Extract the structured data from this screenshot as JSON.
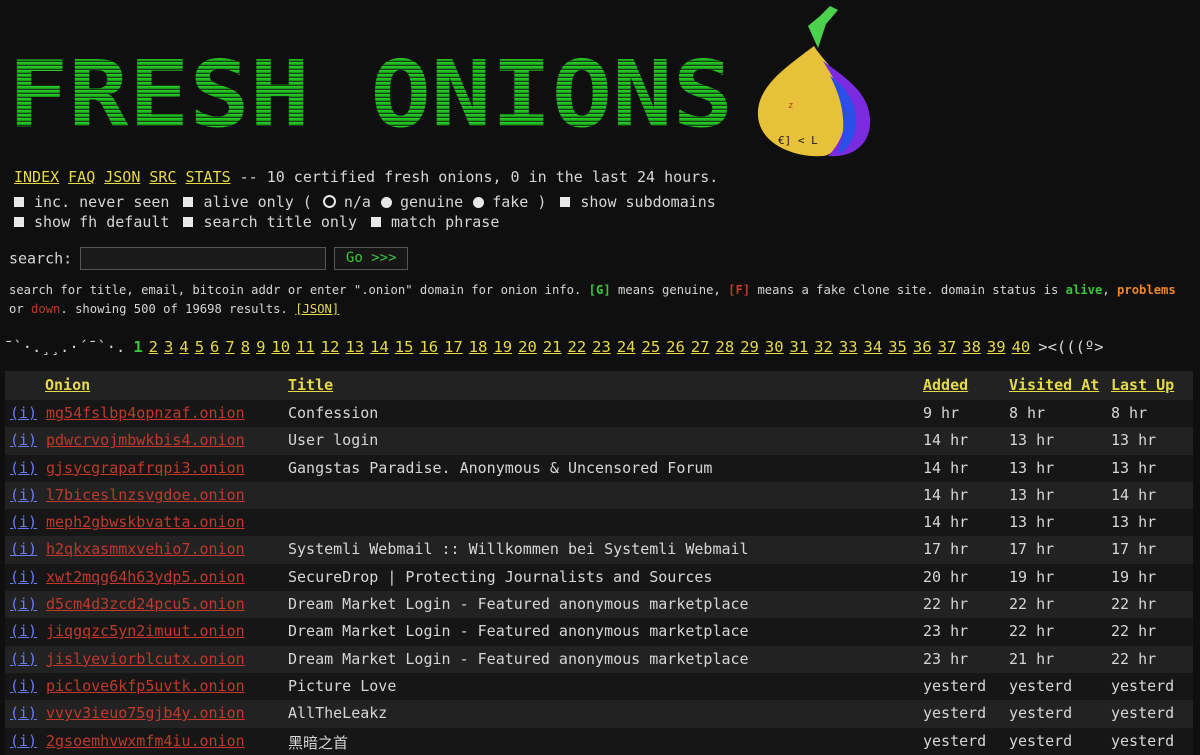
{
  "brand": {
    "logo_text": "FRESH ONIONS"
  },
  "nav": {
    "links": [
      "INDEX",
      "FAQ",
      "JSON",
      "SRC",
      "STATS"
    ],
    "status": "-- 10 certified fresh onions, 0 in the last 24 hours."
  },
  "options": {
    "inc_never_seen": "inc. never seen",
    "alive_only": "alive only (",
    "na": "n/a",
    "genuine": "genuine",
    "fake": "fake )",
    "show_subdomains": "show subdomains",
    "show_fh_default": "show fh default",
    "search_title_only": "search title only",
    "match_phrase": "match phrase"
  },
  "search": {
    "label": "search:",
    "value": "",
    "go_label": "Go >>>"
  },
  "help": {
    "p1": "search for title, email, bitcoin addr or enter \".onion\" domain for onion info.",
    "g_tag": "[G]",
    "p2": "means genuine,",
    "f_tag": "[F]",
    "p3": "means a fake clone site. domain status is",
    "alive": "alive",
    "comma": ",",
    "problems": "problems",
    "or": "or",
    "down": "down",
    "p4": ". showing 500 of 19698 results.",
    "json_link": "[JSON]"
  },
  "pager": {
    "prefix": "¯`·.¸¸.·´¯`·.",
    "current": "1",
    "pages": [
      "2",
      "3",
      "4",
      "5",
      "6",
      "7",
      "8",
      "9",
      "10",
      "11",
      "12",
      "13",
      "14",
      "15",
      "16",
      "17",
      "18",
      "19",
      "20",
      "21",
      "22",
      "23",
      "24",
      "25",
      "26",
      "27",
      "28",
      "29",
      "30",
      "31",
      "32",
      "33",
      "34",
      "35",
      "36",
      "37",
      "38",
      "39",
      "40"
    ],
    "suffix": "><(((º>"
  },
  "table": {
    "headers": {
      "onion": "Onion",
      "title": "Title",
      "added": "Added",
      "visited": "Visited At",
      "last_up": "Last Up"
    },
    "info_label": "(i)",
    "rows": [
      {
        "onion": "mg54fslbp4opnzaf.onion",
        "title": "Confession",
        "added": "9 hr",
        "visited": "8 hr",
        "last_up": "8 hr"
      },
      {
        "onion": "pdwcrvojmbwkbis4.onion",
        "title": "User login",
        "added": "14 hr",
        "visited": "13 hr",
        "last_up": "13 hr"
      },
      {
        "onion": "gjsycgrapafrqpi3.onion",
        "title": "Gangstas Paradise. Anonymous & Uncensored Forum",
        "added": "14 hr",
        "visited": "13 hr",
        "last_up": "13 hr"
      },
      {
        "onion": "l7biceslnzsvgdoe.onion",
        "title": "",
        "added": "14 hr",
        "visited": "13 hr",
        "last_up": "14 hr"
      },
      {
        "onion": "meph2gbwskbvatta.onion",
        "title": "",
        "added": "14 hr",
        "visited": "13 hr",
        "last_up": "13 hr"
      },
      {
        "onion": "h2qkxasmmxvehio7.onion",
        "title": "Systemli Webmail :: Willkommen bei Systemli Webmail",
        "added": "17 hr",
        "visited": "17 hr",
        "last_up": "17 hr"
      },
      {
        "onion": "xwt2mqg64h63ydp5.onion",
        "title": "SecureDrop | Protecting Journalists and Sources",
        "added": "20 hr",
        "visited": "19 hr",
        "last_up": "19 hr"
      },
      {
        "onion": "d5cm4d3zcd24pcu5.onion",
        "title": "Dream Market Login - Featured anonymous marketplace",
        "added": "22 hr",
        "visited": "22 hr",
        "last_up": "22 hr"
      },
      {
        "onion": "jiqgqzc5yn2imuut.onion",
        "title": "Dream Market Login - Featured anonymous marketplace",
        "added": "23 hr",
        "visited": "22 hr",
        "last_up": "22 hr"
      },
      {
        "onion": "jislyeviorblcutx.onion",
        "title": "Dream Market Login - Featured anonymous marketplace",
        "added": "23 hr",
        "visited": "21 hr",
        "last_up": "22 hr"
      },
      {
        "onion": "piclove6kfp5uvtk.onion",
        "title": "Picture Love",
        "added": "yesterd",
        "visited": "yesterd",
        "last_up": "yesterd"
      },
      {
        "onion": "vvyv3ieuo75gjb4y.onion",
        "title": "AllTheLeakz",
        "added": "yesterd",
        "visited": "yesterd",
        "last_up": "yesterd"
      },
      {
        "onion": "2gsoemhvwxmfm4iu.onion",
        "title": "黑暗之首",
        "added": "yesterd",
        "visited": "yesterd",
        "last_up": "yesterd"
      }
    ]
  }
}
